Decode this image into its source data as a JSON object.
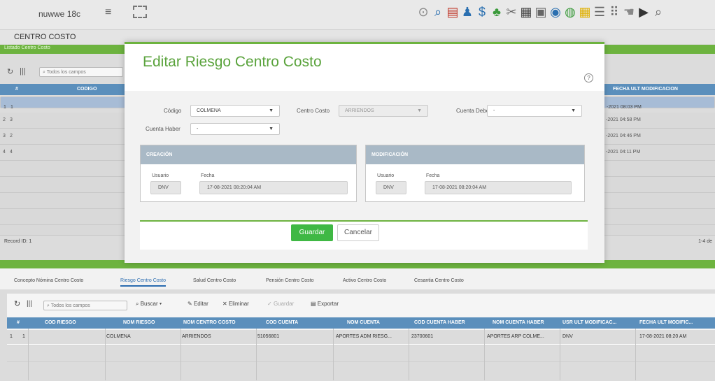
{
  "app": {
    "brand": "nuwwe 18c",
    "menu_icon": "hamburger-icon",
    "fullscreen_icon": "fullscreen-icon"
  },
  "toolbar_icons": [
    "help-icon",
    "search-doc-icon",
    "document-icon",
    "person-money-icon",
    "dollar-icon",
    "people-icon",
    "tools-icon",
    "calculator-icon",
    "report-icon",
    "dashboard-icon",
    "database-icon",
    "grid-icon",
    "list-icon",
    "apps-icon",
    "hand-icon",
    "play-icon",
    "search-icon"
  ],
  "page": {
    "title": "CENTRO COSTO",
    "section": "Listado Centro Costo"
  },
  "grid1": {
    "search_placeholder": "Todos los campos",
    "headers": {
      "num": "#",
      "codigo": "CODIGO",
      "fecha": "FECHA ULT MODIFICACION"
    },
    "rows": [
      {
        "num": "1",
        "codigo": "1",
        "fecha": "-2021 08:03 PM"
      },
      {
        "num": "2",
        "codigo": "3",
        "fecha": "-2021 04:58 PM"
      },
      {
        "num": "3",
        "codigo": "2",
        "fecha": "-2021 04:46 PM"
      },
      {
        "num": "4",
        "codigo": "4",
        "fecha": "-2021 04:11 PM"
      }
    ],
    "record_id": "Record ID: 1",
    "range": "1-4 de"
  },
  "tabs": [
    {
      "label": "Concepto Nómina Centro Costo"
    },
    {
      "label": "Riesgo Centro Costo"
    },
    {
      "label": "Salud Centro Costo"
    },
    {
      "label": "Pensión Centro Costo"
    },
    {
      "label": "Activo Centro Costo"
    },
    {
      "label": "Cesantia Centro Costo"
    }
  ],
  "grid2": {
    "search_placeholder": "Todos los campos",
    "buscar": "Buscar",
    "editar": "Editar",
    "eliminar": "Eliminar",
    "guardar": "Guardar",
    "exportar": "Exportar",
    "headers": [
      "#",
      "COD RIESGO",
      "NOM RIESGO",
      "NOM CENTRO COSTO",
      "COD CUENTA",
      "NOM CUENTA",
      "COD CUENTA HABER",
      "NOM CUENTA HABER",
      "USR ULT MODIFICAC...",
      "FECHA ULT MODIFIC..."
    ],
    "row": [
      "1",
      "1",
      "COLMENA",
      "ARRIENDOS",
      "51056801",
      "APORTES ADM RIESG...",
      "23700601",
      "APORTES ARP COLME...",
      "DNV",
      "17-08-2021 08:20 AM"
    ]
  },
  "modal": {
    "title": "Editar Riesgo Centro Costo",
    "help": "?",
    "codigo_label": "Código",
    "codigo_value": "COLMENA",
    "centro_label": "Centro Costo",
    "centro_value": "ARRIENDOS",
    "debe_label": "Cuenta Debe",
    "debe_value": "-",
    "haber_label": "Cuenta Haber",
    "haber_value": "-",
    "creacion": {
      "title": "CREACIÓN",
      "usuario_label": "Usuario",
      "usuario": "DNV",
      "fecha_label": "Fecha",
      "fecha": "17-08-2021 08:20:04 AM"
    },
    "modificacion": {
      "title": "MODIFICACIÓN",
      "usuario_label": "Usuario",
      "usuario": "DNV",
      "fecha_label": "Fecha",
      "fecha": "17-08-2021 08:20:04 AM"
    },
    "save": "Guardar",
    "cancel": "Cancelar"
  }
}
